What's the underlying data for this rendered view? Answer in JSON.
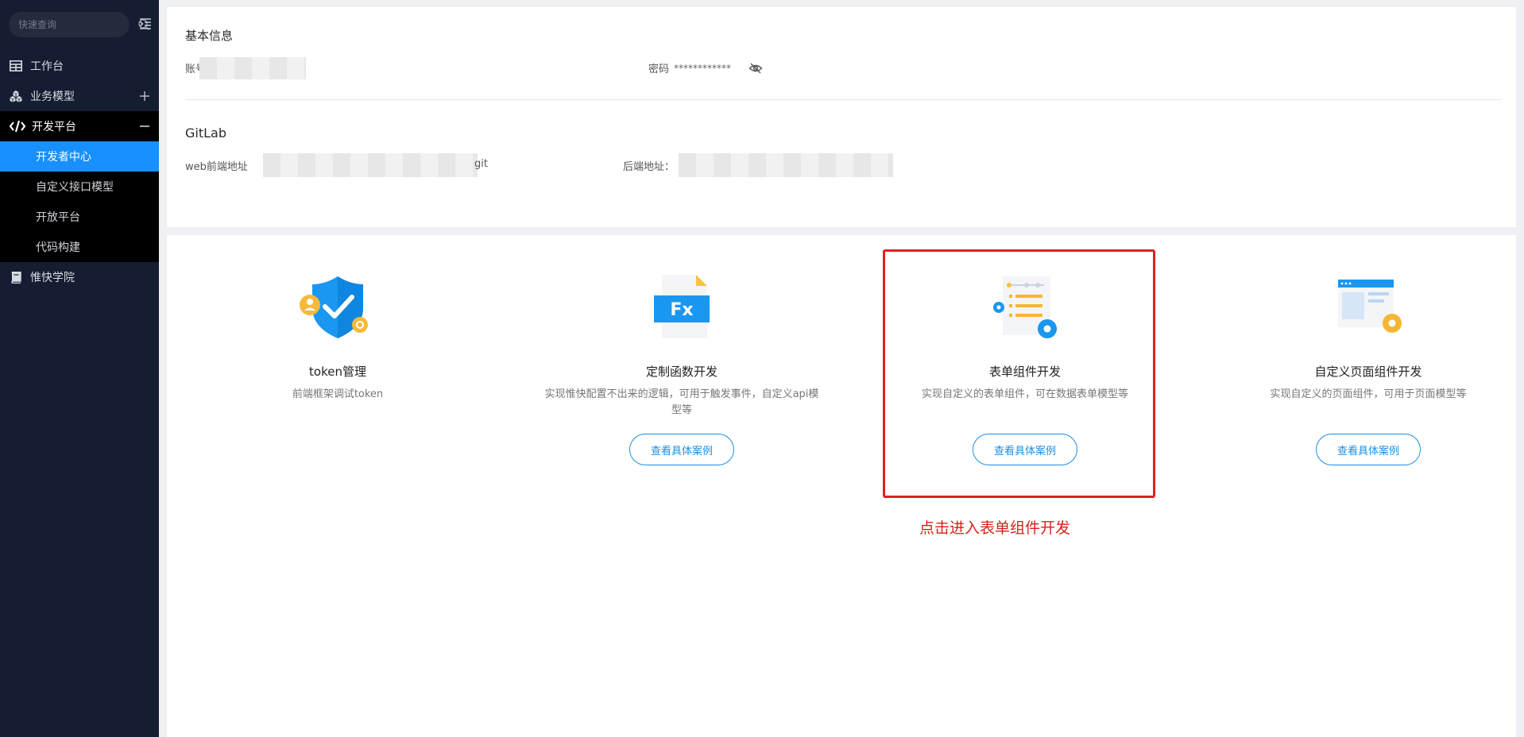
{
  "sidebar": {
    "search_placeholder": "快速查询",
    "items": [
      {
        "label": "工作台",
        "icon": "table-icon"
      },
      {
        "label": "业务模型",
        "icon": "cubes-icon",
        "expand": "plus-icon"
      },
      {
        "label": "开发平台",
        "icon": "code-icon",
        "expand": "minus-icon"
      },
      {
        "label": "惟快学院",
        "icon": "book-icon"
      }
    ],
    "submenu": [
      "开发者中心",
      "自定义接口模型",
      "开放平台",
      "代码构建"
    ],
    "active_submenu": "开发者中心"
  },
  "basic_info": {
    "title": "基本信息",
    "account_label": "账号",
    "password_label": "密码",
    "password_mask": "************"
  },
  "gitlab": {
    "title": "GitLab",
    "web_label": "web前端地址",
    "web_suffix": "git",
    "backend_label": "后端地址："
  },
  "cards": [
    {
      "title": "token管理",
      "desc": "前端框架调试token",
      "button": ""
    },
    {
      "title": "定制函数开发",
      "desc": "实现惟快配置不出来的逻辑，可用于触发事件，自定义api模型等",
      "button": "查看具体案例"
    },
    {
      "title": "表单组件开发",
      "desc": "实现自定义的表单组件，可在数据表单模型等",
      "button": "查看具体案例"
    },
    {
      "title": "自定义页面组件开发",
      "desc": "实现自定义的页面组件，可用于页面模型等",
      "button": "查看具体案例"
    }
  ],
  "icon_glyph": "Fx",
  "annotation": "点击进入表单组件开发",
  "colors": {
    "sidebar_bg": "#141d31",
    "active": "#1890ff",
    "accent": "#1a8fe3",
    "highlight": "#e02020"
  }
}
